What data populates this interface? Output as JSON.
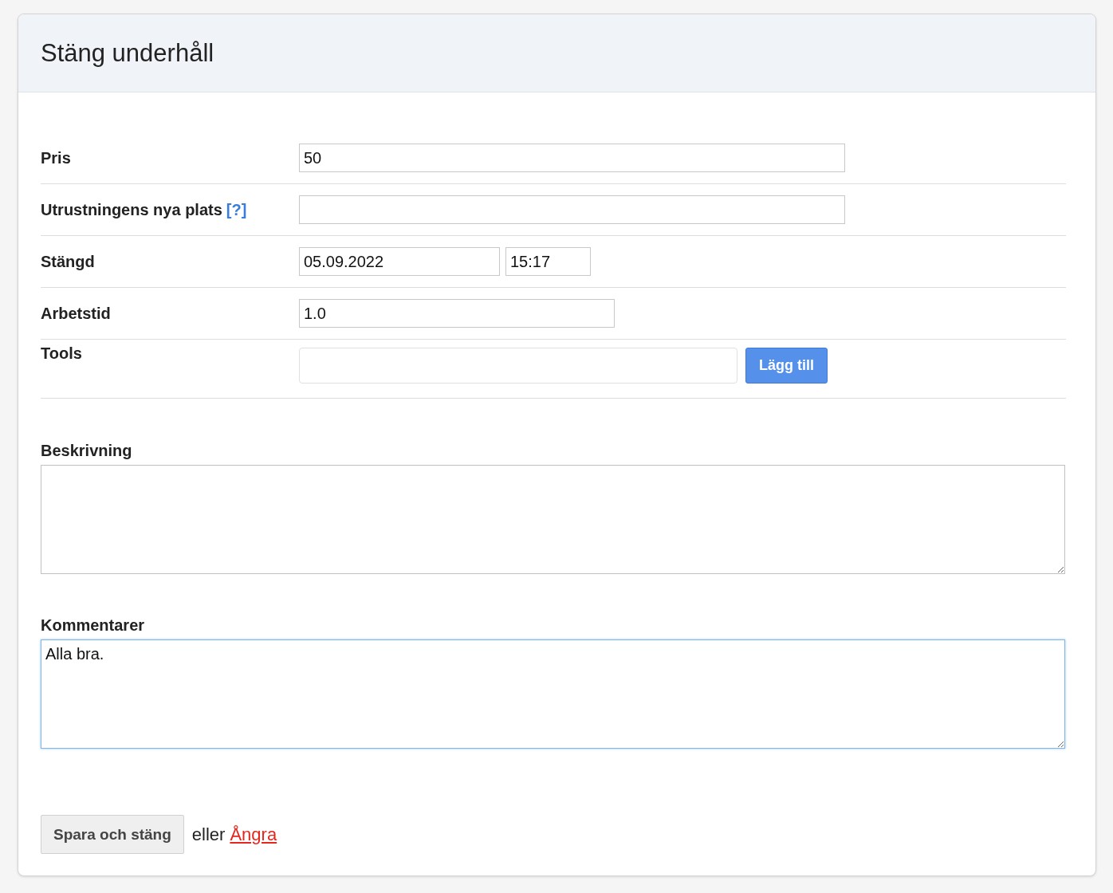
{
  "title": "Stäng underhåll",
  "fields": [
    {
      "kind": "text",
      "label": "Pris",
      "value": "50"
    },
    {
      "kind": "text",
      "label": "Utrustningens nya plats",
      "help": "[?]"
    },
    {
      "kind": "datetime",
      "label": "Stängd",
      "date": "05.09.2022",
      "time": "15:17"
    },
    {
      "kind": "short",
      "label": "Arbetstid",
      "value": "1.0"
    },
    {
      "kind": "add",
      "label": "Tools",
      "button": "Lägg till"
    }
  ],
  "textareas": [
    {
      "label": "Beskrivning",
      "focused": false
    },
    {
      "label": "Kommentarer",
      "value": "Alla bra.",
      "focused": true
    }
  ],
  "footer": {
    "save": "Spara och stäng",
    "or": "eller",
    "cancel": "Ångra"
  }
}
